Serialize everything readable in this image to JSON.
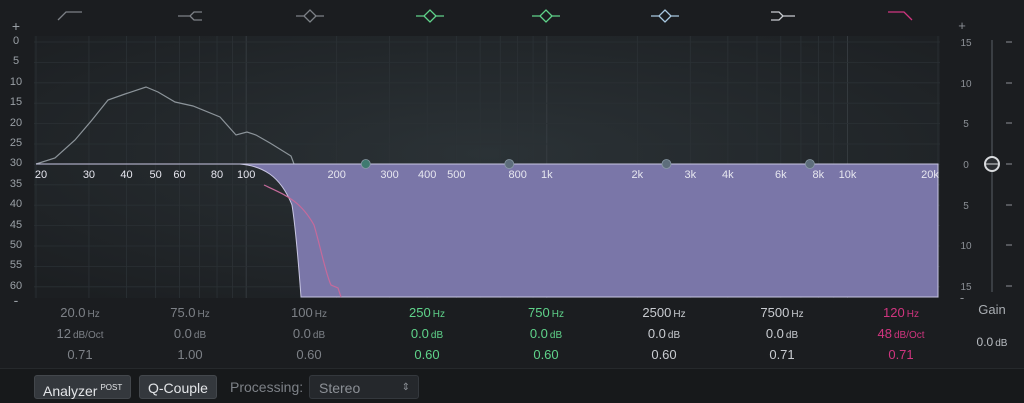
{
  "left_scale": {
    "plus": "+",
    "minus": "-",
    "labels": [
      "0",
      "5",
      "10",
      "15",
      "20",
      "25",
      "30",
      "35",
      "40",
      "45",
      "50",
      "55",
      "60"
    ]
  },
  "right_scale": {
    "plus": "+",
    "minus": "-",
    "labels": [
      "15",
      "10",
      "5",
      "0",
      "5",
      "10",
      "15"
    ]
  },
  "freq_axis": [
    {
      "label": "20",
      "hz": 20
    },
    {
      "label": "30",
      "hz": 30
    },
    {
      "label": "40",
      "hz": 40
    },
    {
      "label": "50",
      "hz": 50
    },
    {
      "label": "60",
      "hz": 60
    },
    {
      "label": "80",
      "hz": 80
    },
    {
      "label": "100",
      "hz": 100
    },
    {
      "label": "200",
      "hz": 200
    },
    {
      "label": "300",
      "hz": 300
    },
    {
      "label": "400",
      "hz": 400
    },
    {
      "label": "500",
      "hz": 500
    },
    {
      "label": "800",
      "hz": 800
    },
    {
      "label": "1k",
      "hz": 1000
    },
    {
      "label": "2k",
      "hz": 2000
    },
    {
      "label": "3k",
      "hz": 3000
    },
    {
      "label": "4k",
      "hz": 4000
    },
    {
      "label": "6k",
      "hz": 6000
    },
    {
      "label": "8k",
      "hz": 8000
    },
    {
      "label": "10k",
      "hz": 10000
    },
    {
      "label": "20k",
      "hz": 20000
    }
  ],
  "band_icons": [
    {
      "name": "lowcut-icon",
      "color": "#7d8187"
    },
    {
      "name": "lowshelf-icon",
      "color": "#7d8187"
    },
    {
      "name": "bell-icon",
      "color": "#7d8187"
    },
    {
      "name": "bell-icon",
      "color": "#5fd38a"
    },
    {
      "name": "bell-icon",
      "color": "#5fd38a"
    },
    {
      "name": "bell-icon",
      "color": "#a8c8e0"
    },
    {
      "name": "highshelf-icon",
      "color": "#c9ccd1"
    },
    {
      "name": "highcut-icon",
      "color": "#d0357f"
    }
  ],
  "bands": [
    {
      "freq": "20.0",
      "freq_unit": "Hz",
      "gain": "12",
      "gain_unit": "dB/Oct",
      "q": "0.71",
      "style": "off"
    },
    {
      "freq": "75.0",
      "freq_unit": "Hz",
      "gain": "0.0",
      "gain_unit": "dB",
      "q": "1.00",
      "style": "off"
    },
    {
      "freq": "100",
      "freq_unit": "Hz",
      "gain": "0.0",
      "gain_unit": "dB",
      "q": "0.60",
      "style": "off"
    },
    {
      "freq": "250",
      "freq_unit": "Hz",
      "gain": "0.0",
      "gain_unit": "dB",
      "q": "0.60",
      "style": "green"
    },
    {
      "freq": "750",
      "freq_unit": "Hz",
      "gain": "0.0",
      "gain_unit": "dB",
      "q": "0.60",
      "style": "green"
    },
    {
      "freq": "2500",
      "freq_unit": "Hz",
      "gain": "0.0",
      "gain_unit": "dB",
      "q": "0.60",
      "style": "white"
    },
    {
      "freq": "7500",
      "freq_unit": "Hz",
      "gain": "0.0",
      "gain_unit": "dB",
      "q": "0.71",
      "style": "white"
    },
    {
      "freq": "120",
      "freq_unit": "Hz",
      "gain": "48",
      "gain_unit": "dB/Oct",
      "q": "0.71",
      "style": "mag"
    }
  ],
  "band_nodes_hz": [
    250,
    750,
    2500,
    7500
  ],
  "gain": {
    "title": "Gain",
    "value": "0.0",
    "unit": "dB",
    "level_db": 0
  },
  "footer": {
    "analyzer_label": "Analyzer",
    "analyzer_sup": "POST",
    "qcouple_label": "Q-Couple",
    "processing_label": "Processing:",
    "processing_value": "Stereo"
  },
  "colors": {
    "fill": "#7a76a8",
    "green": "#5fd38a",
    "magenta": "#d0357f"
  }
}
